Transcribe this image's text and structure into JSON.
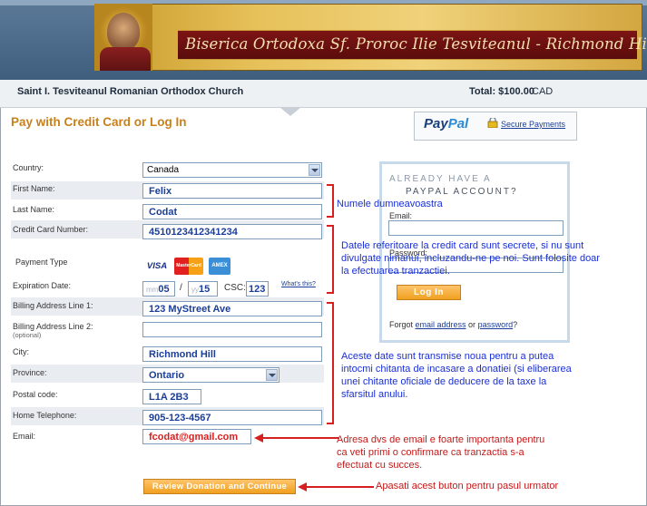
{
  "banner": {
    "title": "Biserica Ortodoxa Sf. Proroc Ilie Tesviteanul - Richmond Hill"
  },
  "merchant": {
    "name": "Saint I. Tesviteanul Romanian Orthodox Church",
    "total_label": "Total: $100.00",
    "currency": "CAD"
  },
  "page": {
    "heading": "Pay with Credit Card or Log In"
  },
  "paypal": {
    "logo_a": "Pay",
    "logo_b": "Pal",
    "secure_link": "Secure Payments"
  },
  "form": {
    "country": {
      "label": "Country:",
      "value": "Canada"
    },
    "first_name": {
      "label": "First Name:",
      "value": "Felix"
    },
    "last_name": {
      "label": "Last Name:",
      "value": "Codat"
    },
    "card_number": {
      "label": "Credit Card Number:",
      "value": "4510123412341234"
    },
    "payment_type": {
      "label": "Payment Type",
      "cards": [
        "VISA",
        "MasterCard",
        "AMEX"
      ]
    },
    "expiration": {
      "label": "Expiration Date:",
      "month_placeholder": "mm",
      "month": "05",
      "separator": "/",
      "year_placeholder": "yy",
      "year": "15",
      "csc_label": "CSC:",
      "csc": "123",
      "whats_this": "What's this?"
    },
    "billing1": {
      "label": "Billing Address Line 1:",
      "value": "123 MyStreet Ave"
    },
    "billing2": {
      "label": "Billing Address Line 2:",
      "sublabel": "(optional)",
      "value": ""
    },
    "city": {
      "label": "City:",
      "value": "Richmond Hill"
    },
    "province": {
      "label": "Province:",
      "value": "Ontario"
    },
    "postal": {
      "label": "Postal code:",
      "value": "L1A 2B3"
    },
    "phone": {
      "label": "Home Telephone:",
      "value": "905-123-4567"
    },
    "email": {
      "label": "Email:",
      "value": "fcodat@gmail.com"
    },
    "review_button": "Review Donation and Continue"
  },
  "login": {
    "title_line1": "ALREADY HAVE A",
    "title_line2": "PAYPAL ACCOUNT?",
    "email_label": "Email:",
    "password_label": "Password:",
    "button": "Log In",
    "forgot_prefix": "Forgot ",
    "forgot_email": "email address",
    "forgot_or": " or ",
    "forgot_password": "password",
    "forgot_suffix": "?"
  },
  "annotations": {
    "name_note": "Numele dumneavoastra",
    "card_note_1": "Datele referitoare la credit card sunt secrete, si nu sunt",
    "card_note_2": "divulgate nimanui, incluzandu-ne pe noi. Sunt folosite doar",
    "card_note_3": "la efectuarea tranzactiei.",
    "address_note_1": "Aceste date sunt transmise noua pentru a putea",
    "address_note_2": "intocmi chitanta de incasare a donatiei (si eliberarea",
    "address_note_3": "unei chitante oficiale de deducere de la taxe la",
    "address_note_4": "sfarsitul anului.",
    "email_note_1": "Adresa dvs de email e foarte importanta pentru",
    "email_note_2": "ca veti primi o confirmare ca tranzactia s-a",
    "email_note_3": "efectuat cu succes.",
    "button_note": "Apasati acest buton pentru pasul urmator"
  },
  "colors": {
    "accent_orange": "#c7801b",
    "annotation_red": "#d62020",
    "annotation_blue": "#1a2fd6",
    "header_blue": "#3f5e7e",
    "banner_red": "#7d1414"
  }
}
